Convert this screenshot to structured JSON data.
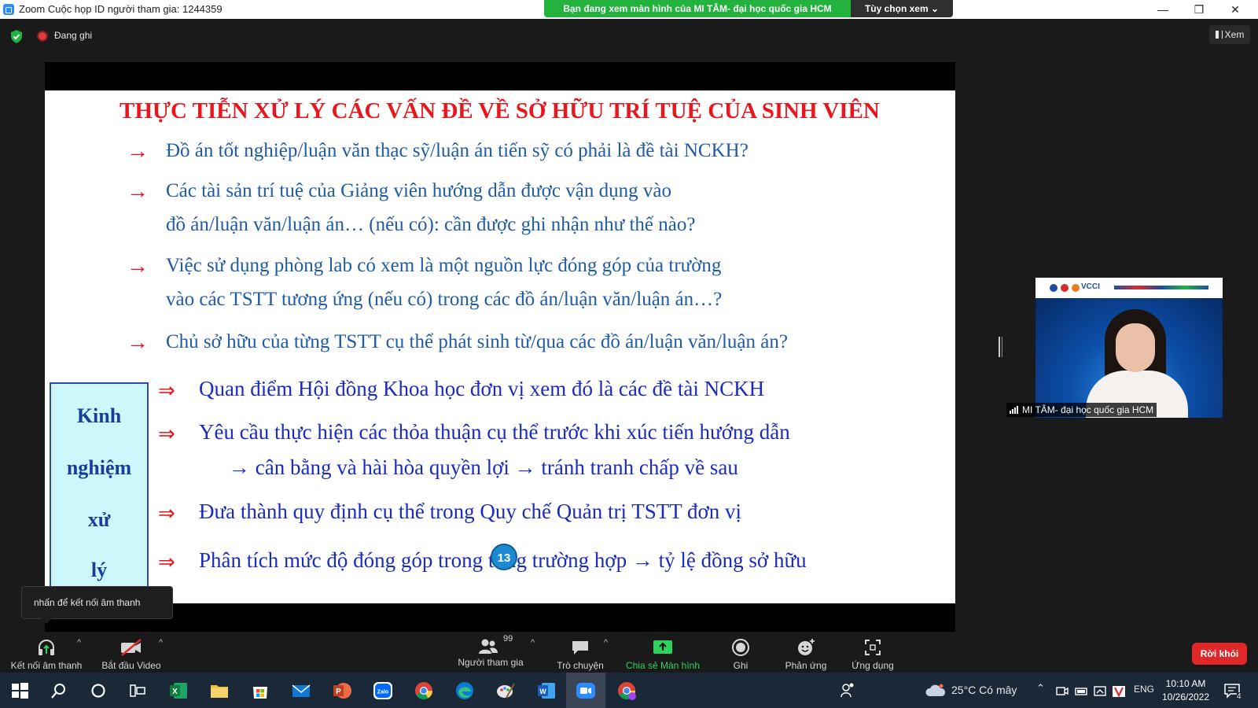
{
  "window": {
    "title": "Zoom Cuộc họp ID người tham gia: 1244359",
    "share_banner": "Bạn đang xem màn hình của MI TÂM- đại học quốc gia HCM",
    "view_options": "Tùy chọn xem ⌄",
    "minimize_glyph": "—",
    "restore_glyph": "❐",
    "close_glyph": "✕"
  },
  "status": {
    "recording_label": "Đang ghi",
    "view_button": "Xem"
  },
  "slide": {
    "title": "THỰC TIỄN XỬ LÝ CÁC VẤN ĐỀ VỀ SỞ HỮU TRÍ TUỆ CỦA SINH VIÊN",
    "arrow_glyph": "→",
    "double_arrow_glyph": "⇒",
    "questions": [
      {
        "lines": [
          "Đồ án tốt nghiệp/luận văn thạc sỹ/luận án tiến sỹ có phải là đề tài NCKH?"
        ]
      },
      {
        "lines": [
          "Các tài sản trí tuệ của Giảng viên hướng dẫn được vận dụng vào",
          "đồ án/luận văn/luận án… (nếu có): cần được ghi nhận như thế nào?"
        ]
      },
      {
        "lines": [
          "Việc sử dụng phòng lab có xem là một nguồn lực đóng góp của trường",
          "vào các TSTT tương ứng (nếu có) trong các đồ án/luận văn/luận án…?"
        ]
      },
      {
        "lines": [
          "Chủ sở hữu của từng TSTT cụ thể phát sinh từ/qua các đồ án/luận văn/luận án?"
        ]
      }
    ],
    "experience_words": [
      "Kinh",
      "nghiệm",
      "xử",
      "lý"
    ],
    "experience_items": [
      "Quan điểm Hội đồng Khoa học đơn vị xem đó là các đề tài NCKH",
      "Yêu cầu thực hiện các thỏa thuận cụ thể trước khi xúc tiến hướng dẫn",
      "→  cân bằng và hài hòa quyền lợi → tránh tranh chấp về sau",
      "Đưa thành quy định cụ thể trong Quy chế Quản trị TSTT đơn vị",
      "Phân tích mức độ đóng góp trong từng trường hợp → tỷ lệ đồng sở hữu"
    ],
    "page_number": "13"
  },
  "video": {
    "participant_name": "MI TÂM- đại học quốc gia HCM",
    "banner_text": "VCCI"
  },
  "tooltip": {
    "text": "nhấn để kết nối âm thanh"
  },
  "toolbar": {
    "audio_label": "Kết nối âm thanh",
    "video_label": "Bắt đầu Video",
    "participants_label": "Người tham gia",
    "participants_count": "99",
    "chat_label": "Trò chuyện",
    "share_label": "Chia sẻ Màn hình",
    "record_label": "Ghi",
    "reactions_label": "Phản ứng",
    "apps_label": "Ứng dụng",
    "leave_label": "Rời khỏi",
    "caret_glyph": "^"
  },
  "taskbar": {
    "weather": "25°C  Có mây",
    "language": "ENG",
    "time": "10:10 AM",
    "date": "10/26/2022",
    "notification_count": "4",
    "app_icons": [
      "start-icon",
      "search-icon",
      "cortana-icon",
      "task-view-icon",
      "excel-icon",
      "file-explorer-icon",
      "store-icon",
      "mail-icon",
      "powerpoint-icon",
      "zalo-icon",
      "chrome-icon",
      "edge-icon",
      "paint-icon",
      "word-icon",
      "zoom-icon",
      "chrome-profile-icon"
    ],
    "excel_letter": "X",
    "ppt_letter": "P",
    "word_letter": "W",
    "zalo_text": "Zalo"
  },
  "colors": {
    "slide_title": "#e8161d",
    "question_text": "#1f5ba6",
    "experience_text": "#1b2bbf",
    "share_banner": "#23b23e",
    "leave_button": "#e02828"
  }
}
